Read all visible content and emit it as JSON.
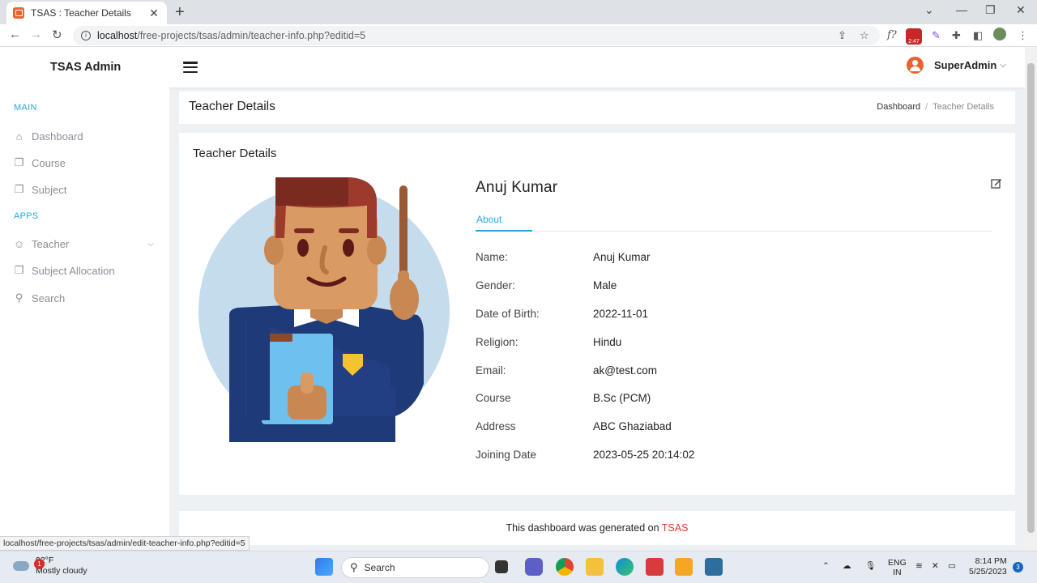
{
  "browser": {
    "tab_title": "TSAS : Teacher Details",
    "url_host": "localhost",
    "url_path": "/free-projects/tsas/admin/teacher-info.php?editid=5",
    "ext_badge": "2:47",
    "status_url": "localhost/free-projects/tsas/admin/edit-teacher-info.php?editid=5"
  },
  "header": {
    "brand": "TSAS Admin",
    "user_name": "SuperAdmin"
  },
  "sidebar": {
    "sections": [
      {
        "title": "MAIN",
        "items": [
          {
            "label": "Dashboard",
            "icon": "home-icon"
          },
          {
            "label": "Course",
            "icon": "copy-icon"
          },
          {
            "label": "Subject",
            "icon": "copy-icon"
          }
        ]
      },
      {
        "title": "APPS",
        "items": [
          {
            "label": "Teacher",
            "icon": "user-icon"
          },
          {
            "label": "Subject Allocation",
            "icon": "copy-icon"
          },
          {
            "label": "Search",
            "icon": "search-icon"
          }
        ]
      }
    ]
  },
  "page": {
    "title": "Teacher Details",
    "breadcrumb": [
      "Dashboard",
      "Teacher Details"
    ]
  },
  "card": {
    "title": "Teacher Details",
    "teacher_name": "Anuj Kumar",
    "tab_label": "About",
    "fields": [
      {
        "label": "Name:",
        "value": "Anuj Kumar"
      },
      {
        "label": "Gender:",
        "value": "Male"
      },
      {
        "label": "Date of Birth:",
        "value": "2022-11-01"
      },
      {
        "label": "Religion:",
        "value": "Hindu"
      },
      {
        "label": "Email:",
        "value": "ak@test.com"
      },
      {
        "label": "Course",
        "value": "B.Sc (PCM)"
      },
      {
        "label": "Address",
        "value": "ABC Ghaziabad"
      },
      {
        "label": "Joining Date",
        "value": "2023-05-25 20:14:02"
      }
    ]
  },
  "footer": {
    "text": "This dashboard was generated on ",
    "brand": "TSAS"
  },
  "taskbar": {
    "temperature": "92°F",
    "weather": "Mostly cloudy",
    "weather_badge": "1",
    "search_label": "Search",
    "lang_line1": "ENG",
    "lang_line2": "IN",
    "time": "8:14 PM",
    "date": "5/25/2023",
    "notif_count": "3"
  },
  "colors": {
    "accent": "#27a9e3",
    "brand_red": "#e53935",
    "avatar_orange": "#e8642c"
  }
}
